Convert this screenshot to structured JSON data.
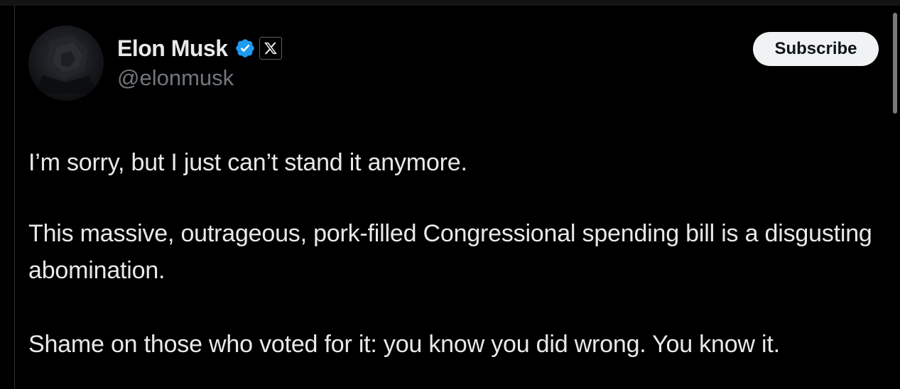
{
  "post": {
    "author": {
      "display_name": "Elon Musk",
      "handle": "@elonmusk",
      "verified_icon": "verified-badge-icon",
      "affiliate_icon": "x-logo-icon"
    },
    "subscribe_label": "Subscribe",
    "paragraphs": [
      "I’m sorry, but I just can’t stand it anymore.",
      "This massive, outrageous, pork-filled Congressional spending bill is a disgusting abomination.",
      "Shame on those who voted for it: you know you did wrong. You know it."
    ]
  },
  "colors": {
    "background": "#000000",
    "primary_text": "#e7e9ea",
    "secondary_text": "#71767b",
    "verified_blue": "#1d9bf0",
    "button_bg": "#eff3f4",
    "button_text": "#0f1419"
  }
}
